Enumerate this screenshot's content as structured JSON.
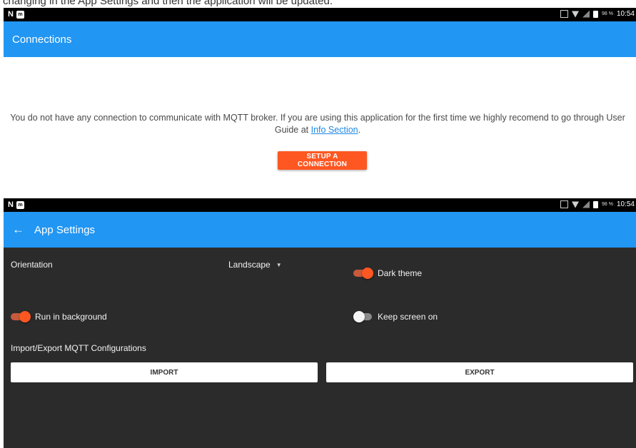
{
  "top_clip": {
    "text": "changing in the App Settings and then the application will be updated."
  },
  "status_bar": {
    "left_letter": "N",
    "left_badge": "m",
    "battery_pct": "98 %",
    "time": "10:54"
  },
  "connections_screen": {
    "title": "Connections",
    "message_main": "You do not have any connection to communicate with MQTT broker. If you are using this application for the first time we highly recomend to go through User Guide at ",
    "message_link": "Info Section",
    "message_end": ".",
    "setup_button": "SETUP A CONNECTION"
  },
  "settings_screen": {
    "title": "App Settings",
    "orientation_label": "Orientation",
    "orientation_value": "Landscape",
    "dark_theme_label": "Dark theme",
    "dark_theme_on": true,
    "run_background_label": "Run in background",
    "run_background_on": true,
    "keep_screen_label": "Keep screen on",
    "keep_screen_on": false,
    "import_export_label": "Import/Export MQTT Configurations",
    "import_button": "IMPORT",
    "export_button": "EXPORT"
  },
  "colors": {
    "app_bar": "#2196f3",
    "accent": "#ff5722",
    "dark_bg": "#2b2b2b",
    "link": "#1e88e5"
  }
}
